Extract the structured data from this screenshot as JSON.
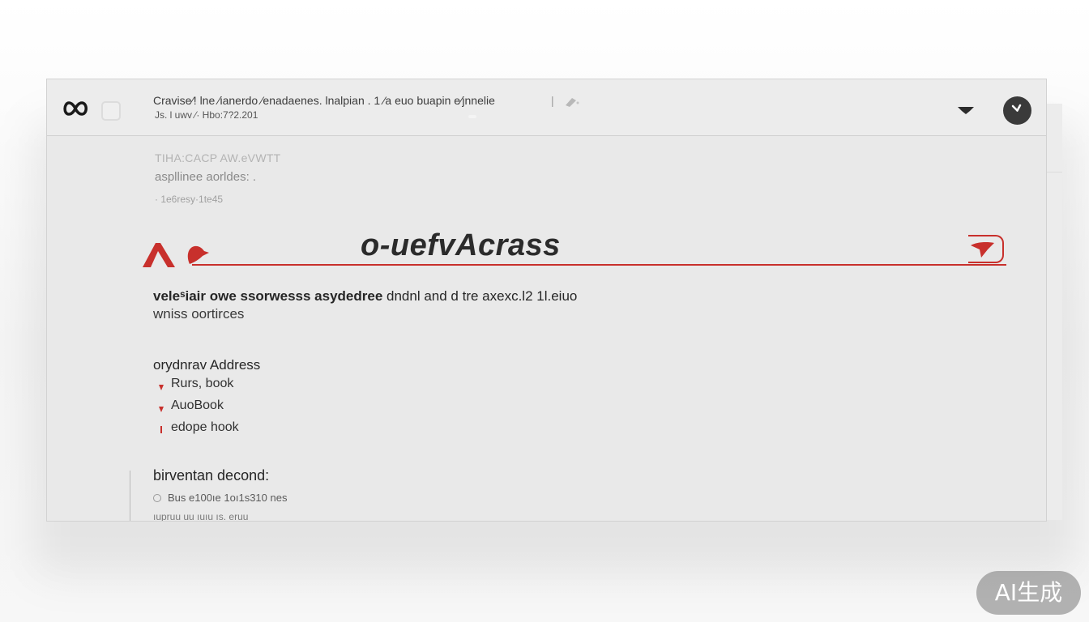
{
  "toolbar": {
    "line1": "Cravise⁄! lne ⁄ianerdo ⁄enadaenes. lnalpian . 1 ⁄a euo buapin e⁄jnnelie",
    "line2": "Js. l uwv ⁄· Hbo:7?2.201",
    "separator": "|",
    "icons": [
      "infinity-logo-icon",
      "square-icon",
      "pin-icon",
      "chevron-down-icon",
      "clock-icon"
    ]
  },
  "intro": {
    "line1": "TIHA:CACP AW.eVWTT",
    "line2": "aspllinee aorldes: .",
    "line3": "· 1e6resy·1te45"
  },
  "address_bar": {
    "title": "o-uefvAcrass",
    "accent_color": "#c8302c"
  },
  "description": {
    "bold_part": "veleˢiair owe ssorwesss asydedree",
    "rest": " dndnl and  d tre axexc.l2 1l.eiuo",
    "line2": "wniss oortirces"
  },
  "section_address": {
    "heading": "orydnrav Address",
    "items": [
      "Rurs, book",
      "AuoBook",
      "edope hook"
    ]
  },
  "section_detail": {
    "heading": "birventan decond:",
    "detail1": "Bus e100ıe 1oı1s310 nes",
    "detail2": "ıupruu uu ıuıu ıs. eruu"
  },
  "watermark": "AI生成"
}
